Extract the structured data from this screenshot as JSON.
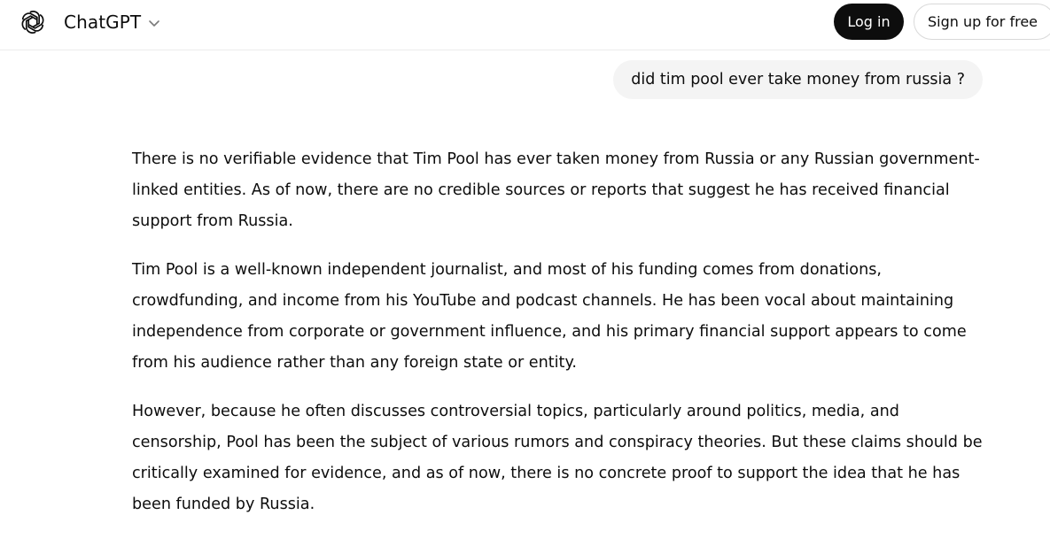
{
  "header": {
    "model_name": "ChatGPT",
    "login_label": "Log in",
    "signup_label": "Sign up for free",
    "logo_icon": "openai-logo-icon",
    "switch_icon": "chevron-down-icon"
  },
  "conversation": {
    "user_message": "did tim pool ever take money from russia ?",
    "assistant_paragraphs": [
      "There is no verifiable evidence that Tim Pool has ever taken money from Russia or any Russian government-linked entities. As of now, there are no credible sources or reports that suggest he has received financial support from Russia.",
      "Tim Pool is a well-known independent journalist, and most of his funding comes from donations, crowdfunding, and income from his YouTube and podcast channels. He has been vocal about maintaining independence from corporate or government influence, and his primary financial support appears to come from his audience rather than any foreign state or entity.",
      "However, because he often discusses controversial topics, particularly around politics, media, and censorship, Pool has been the subject of various rumors and conspiracy theories. But these claims should be critically examined for evidence, and as of now, there is no concrete proof to support the idea that he has been funded by Russia."
    ]
  },
  "colors": {
    "text": "#0d0d0d",
    "user_bubble": "#f4f4f4",
    "login_bg": "#0d0d0d",
    "border": "#d9d9d9"
  }
}
